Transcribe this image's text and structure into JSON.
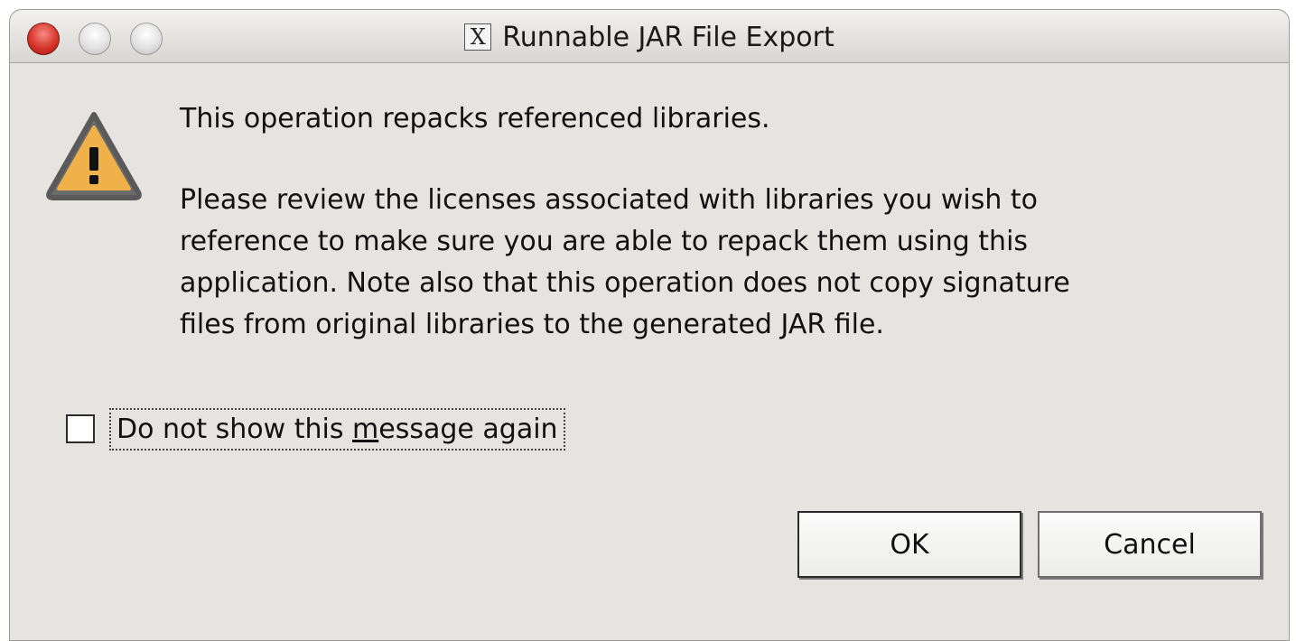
{
  "window": {
    "title": "Runnable JAR File Export",
    "title_icon": "x11-icon"
  },
  "dialog": {
    "icon": "warning-icon",
    "message_line1": "This operation repacks referenced libraries.",
    "message_para2": [
      "Please review the licenses associated with libraries you wish to",
      "reference to make sure you are able to repack them using this",
      "application. Note also that this operation does not copy signature",
      "files from original libraries to the generated JAR file."
    ]
  },
  "checkbox": {
    "label_before": "Do not show this ",
    "label_mnemonic": "m",
    "label_after": "essage again",
    "checked": false
  },
  "buttons": {
    "ok_label": "OK",
    "cancel_label": "Cancel"
  },
  "colors": {
    "warning_fill": "#f0b04a",
    "warning_border": "#6b6b6b",
    "close_button": "#d8352b",
    "window_bg": "#e6e4e0"
  }
}
